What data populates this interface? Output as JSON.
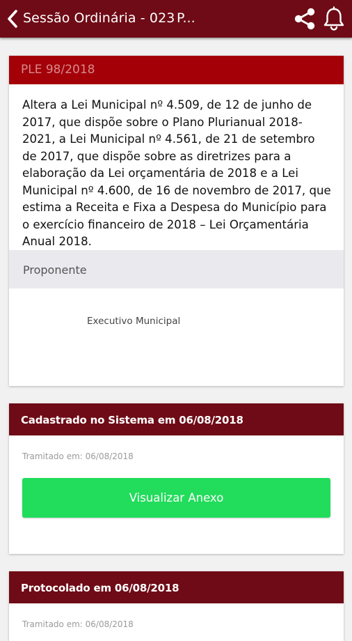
{
  "appbar": {
    "title": "Sessão Ordinária - 023",
    "title_extra": "P..."
  },
  "main_card": {
    "header": "PLE 98/2018",
    "description": "Altera a Lei Municipal nº 4.509, de 12 de junho de 2017, que dispõe sobre o Plano Plurianual 2018-2021, a Lei Municipal nº 4.561, de 21 de setembro de 2017, que dispõe sobre as diretrizes para a elaboração da Lei orçamentária de 2018 e a Lei Municipal nº 4.600, de 16 de novembro de 2017, que estima a Receita e Fixa a Despesa do Município para o exercício financeiro de 2018 – Lei Orçamentária Anual 2018.",
    "proponente_label": "Proponente",
    "proponente_value": "Executivo Municipal"
  },
  "history": [
    {
      "title": "Cadastrado no Sistema em 06/08/2018",
      "tramitado": "Tramitado em: 06/08/2018",
      "button_label": "Visualizar Anexo"
    },
    {
      "title": "Protocolado em 06/08/2018",
      "tramitado": "Tramitado em: 06/08/2018"
    }
  ],
  "colors": {
    "appbar": "#6e0b16",
    "header_red": "#a30008",
    "button_green": "#22dc5b"
  },
  "icons": {
    "back": "chevron-left",
    "share": "share",
    "notifications": "bell"
  }
}
